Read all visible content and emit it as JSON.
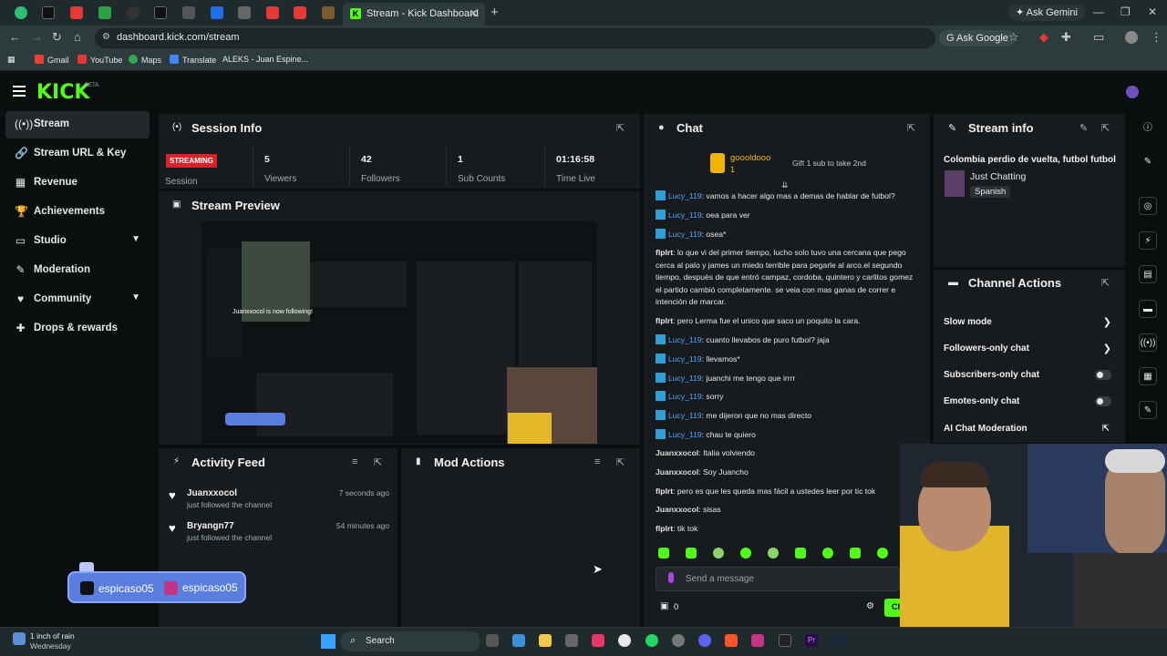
{
  "browser": {
    "active_tab_title": "Stream - Kick Dashboard",
    "ask_gemini": "Ask Gemini",
    "url": "dashboard.kick.com/stream",
    "ask_google": "Ask Google",
    "bookmarks": [
      "Gmail",
      "YouTube",
      "Maps",
      "Translate",
      "ALEKS - Juan Espine..."
    ]
  },
  "header": {
    "logo": "KICK",
    "logo_badge": "BETA"
  },
  "sidebar": {
    "items": [
      {
        "label": "Stream",
        "icon": "stream-icon"
      },
      {
        "label": "Stream URL & Key",
        "icon": "key-icon"
      },
      {
        "label": "Revenue",
        "icon": "revenue-icon"
      },
      {
        "label": "Achievements",
        "icon": "trophy-icon"
      },
      {
        "label": "Studio",
        "icon": "studio-icon"
      },
      {
        "label": "Moderation",
        "icon": "wrench-icon"
      },
      {
        "label": "Community",
        "icon": "community-icon"
      },
      {
        "label": "Drops & rewards",
        "icon": "gift-icon"
      }
    ]
  },
  "session": {
    "title": "Session Info",
    "badge": "STREAMING",
    "badge_caption": "Session",
    "stats": [
      {
        "value": "5",
        "caption": "Viewers"
      },
      {
        "value": "42",
        "caption": "Followers"
      },
      {
        "value": "1",
        "caption": "Sub Counts"
      },
      {
        "value": "01:16:58",
        "caption": "Time Live"
      }
    ]
  },
  "preview": {
    "title": "Stream Preview",
    "overlay_text": "Juanxxocol is now following!"
  },
  "activity": {
    "title": "Activity Feed",
    "items": [
      {
        "name": "Juanxxocol",
        "sub": "just followed the channel",
        "time": "7 seconds ago"
      },
      {
        "name": "Bryangn77",
        "sub": "just followed the channel",
        "time": "54 minutes ago"
      }
    ]
  },
  "mod_actions": {
    "title": "Mod Actions"
  },
  "chat": {
    "title": "Chat",
    "pinned_user": "goooldooo",
    "pinned_count": "1",
    "gift_text": "Gift 1 sub to take 2nd",
    "messages": [
      {
        "user": "Lucy_119",
        "text": ": vamos a hacer algo mas a demas de hablar de futbol?",
        "style": "blue"
      },
      {
        "user": "Lucy_119",
        "text": ": oea para ver",
        "style": "blue"
      },
      {
        "user": "Lucy_119",
        "text": ": osea*",
        "style": "blue"
      },
      {
        "user": "flplrt",
        "text": ": lo que vi del primer tiempo, lucho solo tuvo una cercana que pego cerca al palo y james un miedo terrible para pegarle al arco.el segundo tiempo, después de que entró campaz, cordoba, quintero y carlitos gomez el partido cambió completamente. se veia con mas ganas de correr e intención de marcar.",
        "style": "plain"
      },
      {
        "user": "flplrt",
        "text": ": pero Lerma fue el unico que saco un poquito la cara.",
        "style": "plain"
      },
      {
        "user": "Lucy_119",
        "text": ": cuanto llevabos de puro futbol? jaja",
        "style": "blue"
      },
      {
        "user": "Lucy_119",
        "text": ": llevamos*",
        "style": "blue"
      },
      {
        "user": "Lucy_119",
        "text": ": juanchi me tengo que irrrr",
        "style": "blue"
      },
      {
        "user": "Lucy_119",
        "text": ": sorry",
        "style": "blue"
      },
      {
        "user": "Lucy_119",
        "text": ": me dijeron que no mas directo",
        "style": "blue"
      },
      {
        "user": "Lucy_119",
        "text": ": chau te quiero",
        "style": "blue"
      },
      {
        "user": "Juanxxocol",
        "text": ": Italia volviendo",
        "style": "plain2"
      },
      {
        "user": "Juanxxocol",
        "text": ": Soy Juancho",
        "style": "plain2"
      },
      {
        "user": "flplrt",
        "text": ": pero es que les queda mas fácil a ustedes leer por tic tok",
        "style": "plain"
      },
      {
        "user": "Juanxxocol",
        "text": ": sisas",
        "style": "plain2"
      },
      {
        "user": "flplrt",
        "text": ": tik tok",
        "style": "plain"
      }
    ],
    "input_placeholder": "Send a message",
    "points": "0",
    "send_label": "Ch"
  },
  "stream_info": {
    "title": "Stream info",
    "stream_title": "Colombia perdio de vuelta, futbol futbol",
    "category": "Just Chatting",
    "language": "Spanish"
  },
  "channel_actions": {
    "title": "Channel Actions",
    "items": [
      {
        "label": "Slow mode",
        "control": "chevron"
      },
      {
        "label": "Followers-only chat",
        "control": "chevron"
      },
      {
        "label": "Subscribers-only chat",
        "control": "toggle",
        "on": false
      },
      {
        "label": "Emotes-only chat",
        "control": "toggle",
        "on": false
      },
      {
        "label": "AI Chat Moderation",
        "control": "external"
      }
    ]
  },
  "overlay": {
    "tiktok_handle": "espicaso05",
    "instagram_handle": "espicaso05"
  },
  "taskbar": {
    "weather_line1": "1 inch of rain",
    "weather_line2": "Wednesday",
    "search_label": "Search"
  },
  "colors": {
    "brand": "#53fc18",
    "streaming": "#d8232a",
    "panel": "#181b1e",
    "chat_user": "#4fa8ff"
  }
}
